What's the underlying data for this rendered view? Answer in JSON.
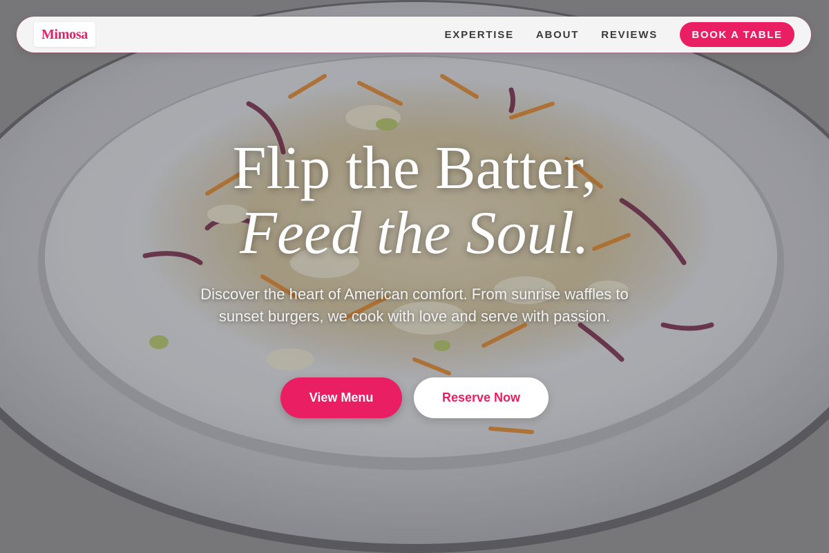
{
  "colors": {
    "accent": "#e91e63",
    "nav_background": "#f4f4f5",
    "hero_text": "#ffffff"
  },
  "nav": {
    "logo": "Mimosa",
    "links": [
      "EXPERTISE",
      "ABOUT",
      "REVIEWS"
    ],
    "cta": "BOOK A TABLE"
  },
  "hero": {
    "background_image": "plate-with-shredded-salad",
    "title_line1": "Flip the Batter,",
    "title_line2": "Feed the Soul.",
    "subtitle": "Discover the heart of American comfort. From sunrise waffles to sunset burgers, we cook with love and serve with passion.",
    "primary_button": "View Menu",
    "secondary_button": "Reserve Now"
  }
}
